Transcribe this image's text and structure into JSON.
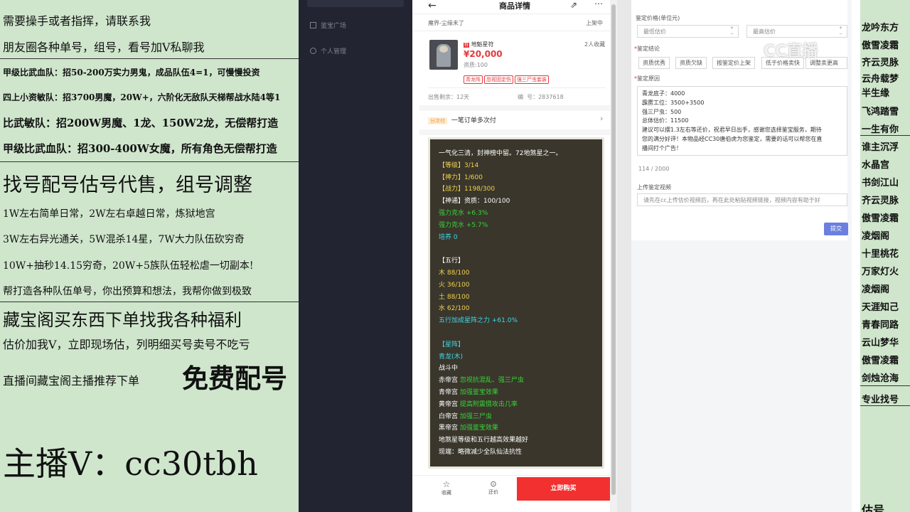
{
  "left_panel": {
    "lines": [
      "需要操手或者指挥，请联系我",
      "朋友圈各种单号，组号，看号加V私聊我",
      "甲级比武血队：招50-200万实力男鬼，成品队伍4=1，可慢慢投资",
      "四上小资敏队：招3700男魔，20W+，六阶化无敌队天梯帮战水陆4等1",
      "比武敏队：招200W男魔、1龙、150W2龙，无偿帮打造",
      "甲级比武血队：招300-400W女魔，所有角色无偿帮打造",
      "找号配号估号代售，组号调整",
      "1W左右简单日常，2W左右卓越日常，炼狱地宫",
      "3W左右异光通关，5W混杀14星，7W大力队伍砍穷奇",
      "10W+抽秒14.15穷奇，20W+5族队伍轻松虐一切副本!",
      "帮打造各种队伍单号，你出预算和想法，我帮你做到极致",
      "藏宝阁买东西下单找我各种福利",
      "估价加我V，立即现场估，列明细买号卖号不吃亏",
      "直播间藏宝阁主播推荐下单",
      "免费配号",
      "主播V：cc30tbh"
    ]
  },
  "dark_sidebar": {
    "items": [
      "鉴宝广场",
      "个人管理"
    ]
  },
  "phone": {
    "title": "商品详情",
    "server": "魔界-尘缘未了",
    "listing_status": "上架中",
    "item_name": "地魁星符",
    "price": "¥20,000",
    "quality": "资质:100",
    "favorites": "2人收藏",
    "tags": [
      "青龙阵",
      "忽视固定伤",
      "强三尸虫套装"
    ],
    "remaining": "出售剩余：12天",
    "serial": "编  号：2837618",
    "promo_badge": "分次付",
    "promo_text": "一笔订单多次付",
    "desc_lines": [
      {
        "t": "一气化三清，封神榜中留。72地煞星之一。",
        "c": "w"
      },
      {
        "t": "【等级】3/14",
        "c": "y"
      },
      {
        "t": "【神力】1/600",
        "c": "y"
      },
      {
        "t": "【战力】1198/300",
        "c": "y"
      },
      {
        "t": "【神通】资质：100/100",
        "c": "w"
      },
      {
        "t": "强力克水 +6.3%",
        "c": "g"
      },
      {
        "t": "强力克水 +5.7%",
        "c": "g"
      },
      {
        "t": "培养 0",
        "c": "c"
      },
      {
        "t": "",
        "c": "w"
      },
      {
        "t": "【五行】",
        "c": "w"
      },
      {
        "t": "木 88/100",
        "c": "y"
      },
      {
        "t": "火 36/100",
        "c": "y"
      },
      {
        "t": "土 88/100",
        "c": "y"
      },
      {
        "t": "水 62/100",
        "c": "y"
      },
      {
        "t": "五行加成星阵之力 +61.0%",
        "c": "c"
      },
      {
        "t": "",
        "c": "w"
      },
      {
        "t": "【星阵】",
        "c": "c"
      },
      {
        "t": "青龙(木)",
        "c": "c"
      },
      {
        "t": "战斗中",
        "c": "w"
      }
    ],
    "palace_lines": [
      {
        "a": "赤帝宫 ",
        "b": "忽视抗混乱、强三尸虫"
      },
      {
        "a": "青帝宫 ",
        "b": "加强鉴宝效果"
      },
      {
        "a": "黄帝宫 ",
        "b": "提高附震慑攻击几率"
      },
      {
        "a": "白帝宫 ",
        "b": "加强三尸虫"
      },
      {
        "a": "黑帝宫 ",
        "b": "加强鉴宝效果"
      }
    ],
    "desc_tail": [
      "地煞星等级和五行越高效果越好",
      "现端：略微减少全队仙法抗性"
    ],
    "bottom": {
      "fav": "收藏",
      "counter": "还价",
      "buy": "立即购买"
    }
  },
  "form": {
    "price_label": "鉴定价格(单位元)",
    "min_placeholder": "最低估价",
    "max_placeholder": "最高估价",
    "conclusion_label": "鉴定结论",
    "conclusions": [
      "资质优秀",
      "资质欠缺",
      "按鉴定价上架",
      "低于价格卖快",
      "调整卖更高"
    ],
    "reason_label": "鉴定原因",
    "reason_lines": [
      "青龙底子：4000",
      "霹雳工位：3500+3500",
      "强三尸虫：500",
      "总体估价：11500",
      "建议可以摆1.3左右等还价，祝君早日出手，感谢您选择鉴宝服务，期待",
      "您的满分好评！本物品经CC30唐伯虎为您鉴定，需要的话可以帮您在直",
      "播间打个广告！"
    ],
    "counter": "114 / 2000",
    "video_label": "上传鉴定视频",
    "video_placeholder": "请先在cc上传估价视频后，再在此处粘贴视频链接，视频内容有助于好",
    "submit": "提交"
  },
  "watermark": "CC直播",
  "right_panel": {
    "items": [
      "龙吟东方",
      "傲雪凌霜",
      "齐云灵脉",
      "云舟载梦",
      "半生缘",
      "飞鸿踏雪",
      "一生有你",
      "谁主沉浮",
      "水晶宫",
      "书剑江山",
      "齐云灵脉",
      "傲雪凌霜",
      "凌烟阁",
      "十里桃花",
      "万家灯火",
      "凌烟阁",
      "天涯知己",
      "青春同路",
      "云山梦华",
      "傲雪凌霜",
      "剑烛沧海",
      "专业找号"
    ],
    "bottom": "估号"
  }
}
